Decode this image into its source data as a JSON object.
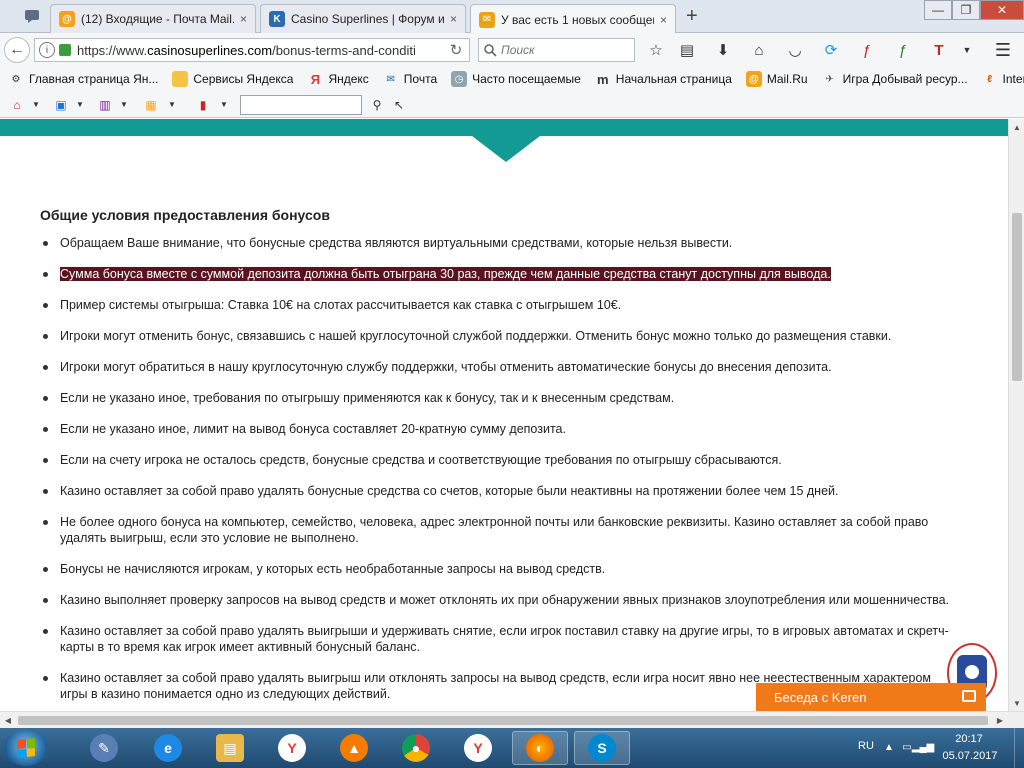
{
  "tabs": [
    {
      "title": "(12) Входящие - Почта Mail.R",
      "favicon": "mail-ru-icon",
      "color": "#f4a21c"
    },
    {
      "title": "Casino Superlines | Форум иг",
      "favicon": "casino-forum-icon",
      "color": "#2b6cb0"
    },
    {
      "title": "У вас есть 1 новых сообщен",
      "favicon": "envelope-icon",
      "color": "#e8a317"
    }
  ],
  "tab_close": "×",
  "new_tab": "+",
  "window_buttons": {
    "minimize": "—",
    "maximize": "❐",
    "close": "✕"
  },
  "nav": {
    "url_prefix": "https://www.",
    "url_host": "casinosuperlines.com",
    "url_path": "/bonus-terms-and-conditi",
    "search_placeholder": "Поиск"
  },
  "bookmarks": [
    {
      "label": "Главная страница Ян...",
      "icon": "yandex-page-icon"
    },
    {
      "label": "Сервисы Яндекса",
      "icon": "folder-icon"
    },
    {
      "label": "Яндекс",
      "icon": "yandex-icon"
    },
    {
      "label": "Почта",
      "icon": "mail-icon"
    },
    {
      "label": "Часто посещаемые",
      "icon": "history-icon"
    },
    {
      "label": "Начальная страница",
      "icon": "start-page-icon"
    },
    {
      "label": "Mail.Ru",
      "icon": "mail-ru-icon"
    },
    {
      "label": "Игра Добывай ресур...",
      "icon": "game-icon"
    },
    {
      "label": "Interzet CRM",
      "icon": "interzet-icon"
    }
  ],
  "page": {
    "heading": "Общие условия предоставления бонусов",
    "items": [
      "Обращаем Ваше внимание, что бонусные средства являются виртуальными средствами, которые нельзя вывести.",
      "Сумма бонуса вместе с суммой депозита должна быть отыграна 30 раз, прежде чем данные средства станут доступны для вывода.",
      "Пример системы отыгрыша: Ставка 10€ на слотах рассчитывается как ставка с отыгрышем 10€.",
      "Игроки могут отменить бонус, связавшись с нашей круглосуточной службой поддержки. Отменить бонус можно только до размещения ставки.",
      "Игроки могут обратиться в нашу круглосуточную службу поддержки, чтобы отменить автоматические бонусы до внесения депозита.",
      "Если не указано иное, требования по отыгрышу применяются как к бонусу, так и к внесенным средствам.",
      "Если не указано иное, лимит на вывод бонуса составляет 20-кратную сумму депозита.",
      "Если на счету игрока не осталось средств, бонусные средства и соответствующие требования по отыгрышу сбрасываются.",
      "Казино оставляет за собой право удалять бонусные средства со счетов, которые были неактивны на протяжении более чем 15 дней.",
      "Не более одного бонуса на компьютер, семейство, человека, адрес электронной почты или банковские реквизиты. Казино оставляет за собой право удалять выигрыш, если это условие не выполнено.",
      "Бонусы не начисляются игрокам, у которых есть необработанные запросы на вывод средств.",
      "Казино выполняет проверку запросов на вывод средств и может отклонять их при обнаружении явных признаков злоупотребления или мошенничества.",
      "Казино оставляет за собой право удалять выигрыши и удерживать снятие, если игрок поставил ставку на другие игры, то в игровых автоматах и скретч-карты в то время как игрок имеет активный бонусный баланс.",
      "Казино оставляет за собой право удалять выигрыш или отклонять запросы на вывод средств, если игра носит явно нее                     неестественным характером игры в казино понимается одно из следующих действий."
    ],
    "highlighted_index": 1,
    "accent_color": "#149a94",
    "highlight_color": "#5a1420"
  },
  "chat": {
    "label": "Беседа с Keren",
    "color": "#f07a1a"
  },
  "taskbar": {
    "apps": [
      {
        "name": "utility-app-icon",
        "color": "#5a7fb5",
        "glyph": "✎"
      },
      {
        "name": "internet-explorer-icon",
        "color": "#1e88e5",
        "glyph": "e"
      },
      {
        "name": "file-explorer-icon",
        "color": "#e8b84a",
        "glyph": "▤"
      },
      {
        "name": "yandex-browser-icon",
        "color": "#e53935",
        "glyph": "Y"
      },
      {
        "name": "avast-icon",
        "color": "#f57c00",
        "glyph": "▲"
      },
      {
        "name": "chrome-icon",
        "color": "#43a047",
        "glyph": "◉"
      },
      {
        "name": "yandex-browser-icon-2",
        "color": "#e53935",
        "glyph": "Y"
      },
      {
        "name": "firefox-icon",
        "color": "#ef6c00",
        "glyph": "◐"
      },
      {
        "name": "skype-icon",
        "color": "#0288d1",
        "glyph": "S"
      }
    ],
    "lang": "RU",
    "time": "20:17",
    "date": "05.07.2017"
  }
}
